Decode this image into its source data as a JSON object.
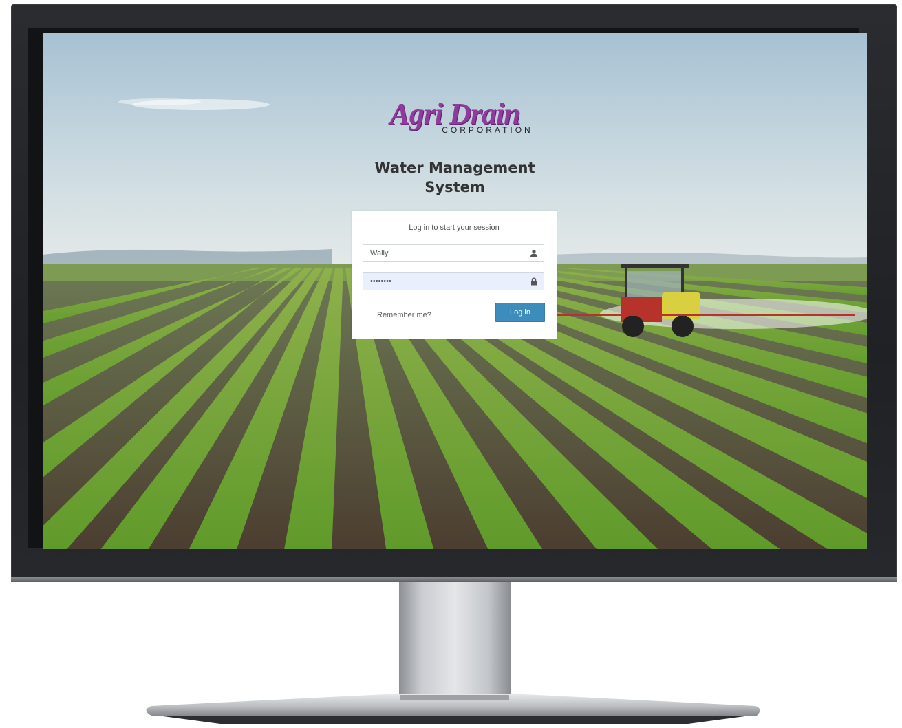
{
  "brand": {
    "logo_main": "Agri Drain",
    "logo_sub": "CORPORATION",
    "logo_color": "#8f3b9c"
  },
  "page": {
    "title_line1": "Water Management",
    "title_line2": "System"
  },
  "login": {
    "message": "Log in to start your session",
    "username_value": "Wally",
    "username_icon": "user-icon",
    "password_value": "••••••••",
    "password_icon": "lock-icon",
    "remember_label": "Remember me?",
    "remember_checked": false,
    "submit_label": "Log in",
    "button_color": "#3c8dbc"
  }
}
